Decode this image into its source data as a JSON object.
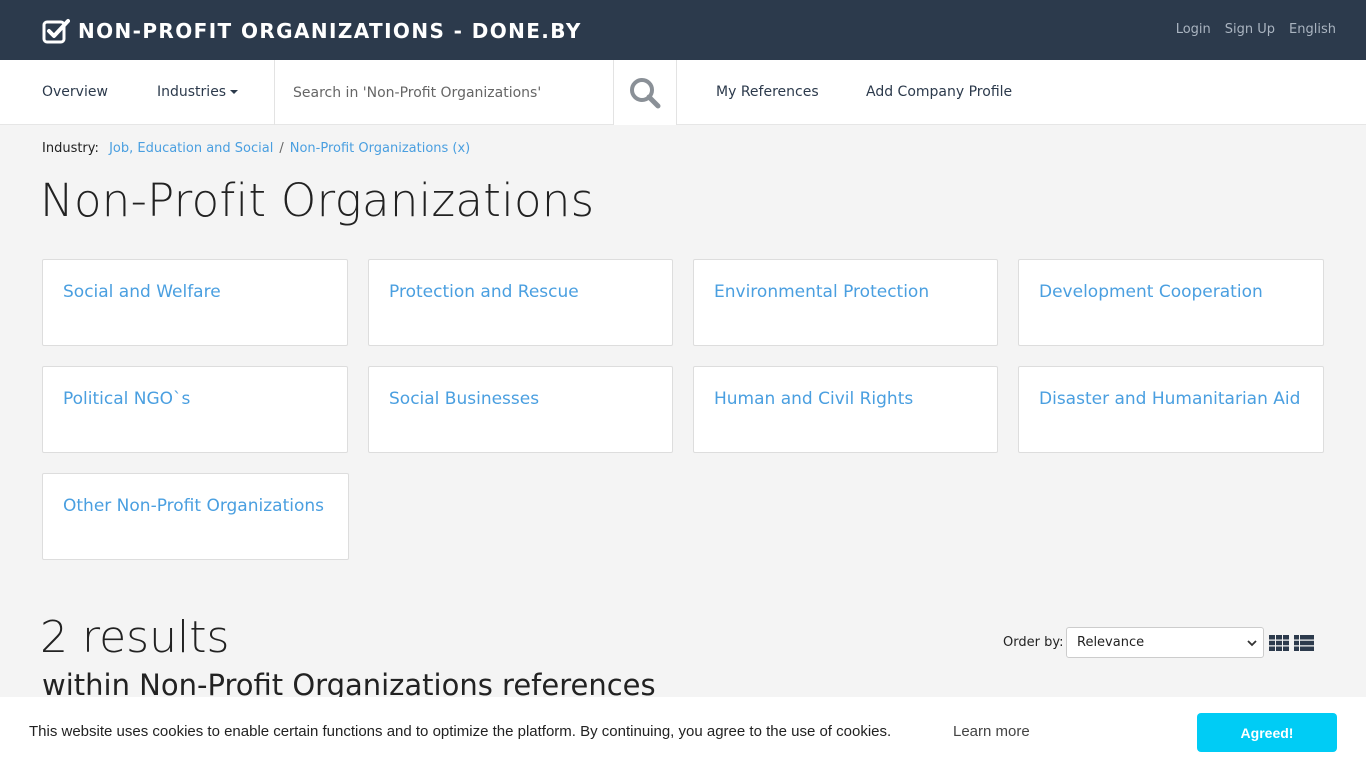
{
  "header": {
    "brand": "NON-PROFIT ORGANIZATIONS - DONE.BY",
    "login": "Login",
    "signup": "Sign Up",
    "language": "English"
  },
  "nav": {
    "overview": "Overview",
    "industries": "Industries",
    "search_placeholder": "Search in 'Non-Profit Organizations'",
    "my_references": "My References",
    "add_company": "Add Company Profile"
  },
  "breadcrumb": {
    "label": "Industry:",
    "items": [
      "Job, Education and Social",
      "Non-Profit Organizations (x)"
    ],
    "separator": "/"
  },
  "page_title": "Non-Profit Organizations",
  "categories": [
    "Social and Welfare",
    "Protection and Rescue",
    "Environmental Protection",
    "Development Cooperation",
    "Political NGO`s",
    "Social Businesses",
    "Human and Civil Rights",
    "Disaster and Humanitarian Aid",
    "Other Non-Profit Organizations"
  ],
  "results": {
    "count_text": "2 results",
    "subtitle": "within Non-Profit Organizations references",
    "order_label": "Order by:",
    "order_value": "Relevance"
  },
  "cookie": {
    "text": "This website uses cookies to enable certain functions and to optimize the platform. By continuing, you agree to the use of cookies.",
    "learn_more": "Learn more",
    "button": "Agreed!"
  },
  "colors": {
    "topbar": "#2c3a4c",
    "link": "#4a9fe0",
    "cookie_button": "#00ccf5"
  },
  "icons": {
    "brand": "checkbox-checked-icon",
    "search": "magnifier-icon",
    "grid_view": "grid-view-icon",
    "list_view": "list-view-icon"
  }
}
